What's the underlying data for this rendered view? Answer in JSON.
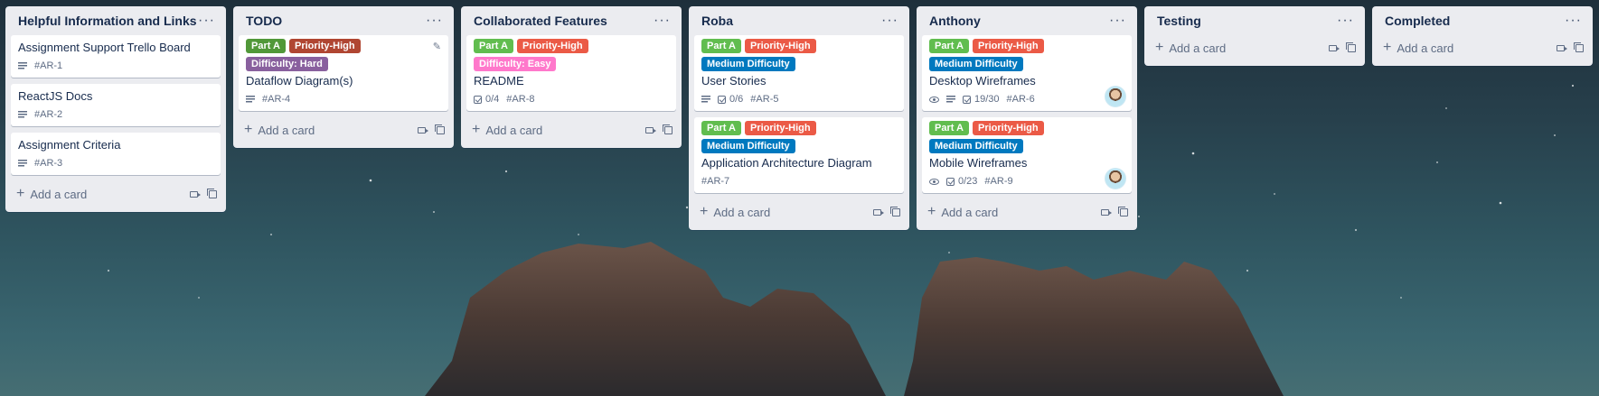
{
  "colors": {
    "green": "#61bd4f",
    "red": "#eb5a46",
    "darkred": "#b04632",
    "purple": "#89609e",
    "pink": "#ff78cb",
    "blue": "#0079bf",
    "darkgreen": "#519839"
  },
  "lists": [
    {
      "title": "Helpful Information and Links",
      "add_label": "Add a card",
      "cards": [
        {
          "title": "Assignment Support Trello Board",
          "id": "#AR-1"
        },
        {
          "title": "ReactJS Docs",
          "id": "#AR-2"
        },
        {
          "title": "Assignment Criteria",
          "id": "#AR-3"
        }
      ]
    },
    {
      "title": "TODO",
      "add_label": "Add a card",
      "cards": [
        {
          "labels": [
            "Part A",
            "Priority-High",
            "Difficulty: Hard"
          ],
          "title": "Dataflow Diagram(s)",
          "id": "#AR-4"
        }
      ]
    },
    {
      "title": "Collaborated Features",
      "add_label": "Add a card",
      "cards": [
        {
          "labels": [
            "Part A",
            "Priority-High",
            "Difficulty: Easy"
          ],
          "title": "README",
          "checklist": "0/4",
          "id": "#AR-8"
        }
      ]
    },
    {
      "title": "Roba",
      "add_label": "Add a card",
      "cards": [
        {
          "labels": [
            "Part A",
            "Priority-High",
            "Medium Difficulty"
          ],
          "title": "User Stories",
          "checklist": "0/6",
          "id": "#AR-5"
        },
        {
          "labels": [
            "Part A",
            "Priority-High",
            "Medium Difficulty"
          ],
          "title": "Application Architecture Diagram",
          "id": "#AR-7"
        }
      ]
    },
    {
      "title": "Anthony",
      "add_label": "Add a card",
      "cards": [
        {
          "labels": [
            "Part A",
            "Priority-High",
            "Medium Difficulty"
          ],
          "title": "Desktop Wireframes",
          "checklist": "19/30",
          "id": "#AR-6"
        },
        {
          "labels": [
            "Part A",
            "Priority-High",
            "Medium Difficulty"
          ],
          "title": "Mobile Wireframes",
          "checklist": "0/23",
          "id": "#AR-9"
        }
      ]
    },
    {
      "title": "Testing",
      "add_label": "Add a card",
      "cards": []
    },
    {
      "title": "Completed",
      "add_label": "Add a card",
      "cards": []
    }
  ]
}
